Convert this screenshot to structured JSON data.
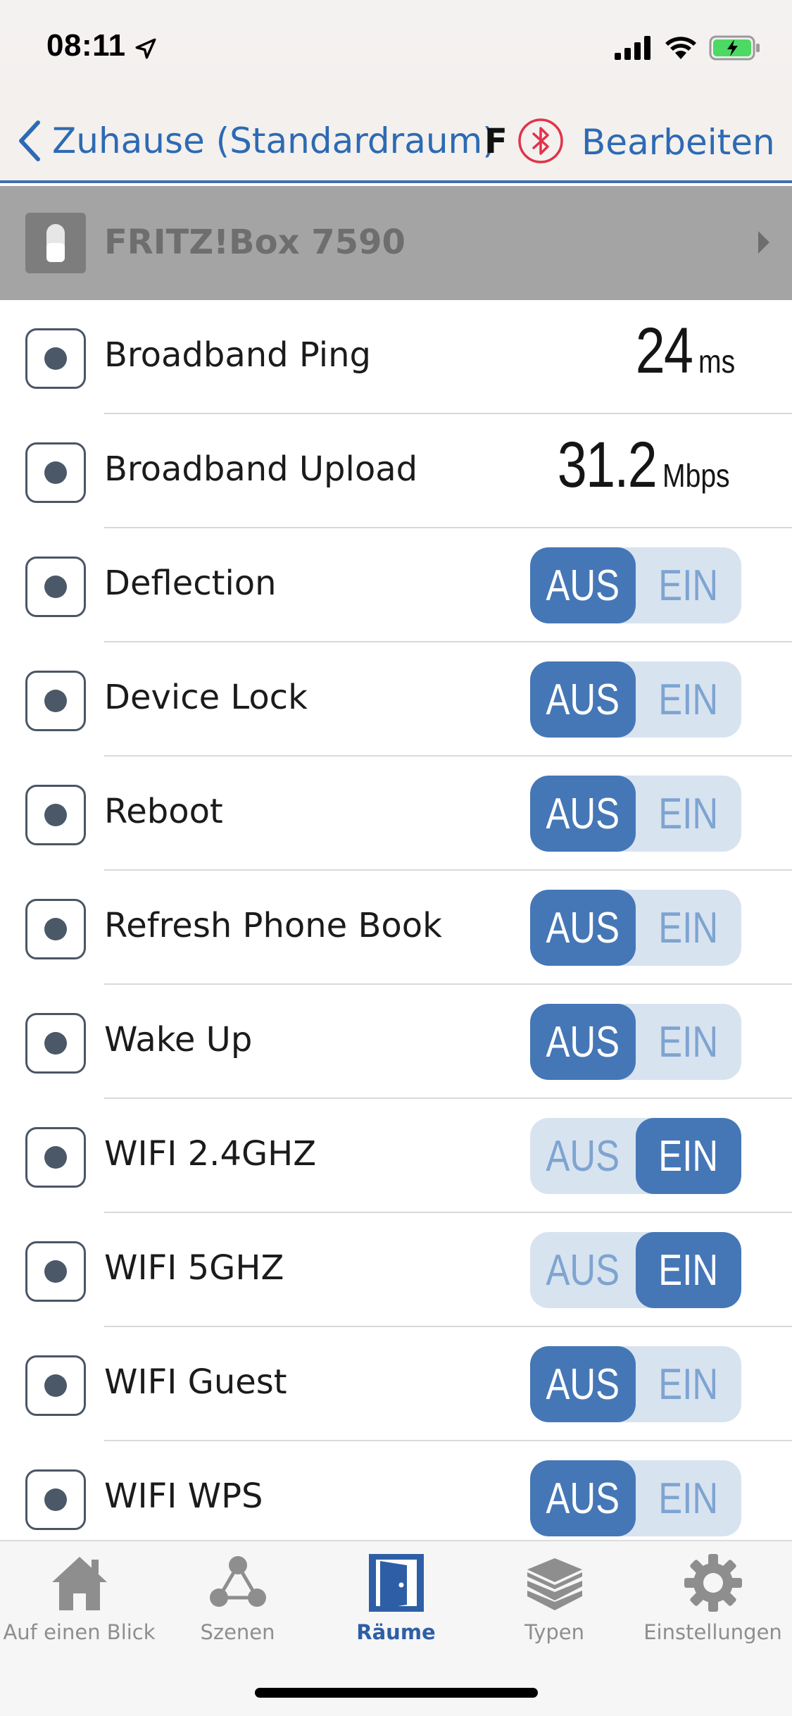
{
  "status": {
    "time": "08:11"
  },
  "nav": {
    "back_label": "Zuhause (Standardraum)",
    "title": "Fl",
    "edit_label": "Bearbeiten"
  },
  "device": {
    "name": "FRITZ!Box 7590"
  },
  "rows": [
    {
      "label": "Broadband Ping",
      "type": "value",
      "value": "24",
      "unit": "ms"
    },
    {
      "label": "Broadband Upload",
      "type": "value",
      "value": "31.2",
      "unit": "Mbps"
    },
    {
      "label": "Deflection",
      "type": "toggle",
      "state": "AUS"
    },
    {
      "label": "Device Lock",
      "type": "toggle",
      "state": "AUS"
    },
    {
      "label": "Reboot",
      "type": "toggle",
      "state": "AUS"
    },
    {
      "label": "Refresh Phone Book",
      "type": "toggle",
      "state": "AUS"
    },
    {
      "label": "Wake Up",
      "type": "toggle",
      "state": "AUS"
    },
    {
      "label": "WIFI 2.4GHZ",
      "type": "toggle",
      "state": "EIN"
    },
    {
      "label": "WIFI 5GHZ",
      "type": "toggle",
      "state": "EIN"
    },
    {
      "label": "WIFI Guest",
      "type": "toggle",
      "state": "AUS"
    },
    {
      "label": "WIFI WPS",
      "type": "toggle",
      "state": "AUS"
    }
  ],
  "toggle_labels": {
    "off": "AUS",
    "on": "EIN"
  },
  "tabs": [
    {
      "label": "Auf einen Blick",
      "icon": "house-icon"
    },
    {
      "label": "Szenen",
      "icon": "scenes-icon"
    },
    {
      "label": "Räume",
      "icon": "door-icon",
      "active": true
    },
    {
      "label": "Typen",
      "icon": "layers-icon"
    },
    {
      "label": "Einstellungen",
      "icon": "gear-icon"
    }
  ],
  "colors": {
    "accent": "#2d6ab3",
    "toggle_active": "#4577b7",
    "toggle_track": "#d8e3f0",
    "bluetooth": "#e0334a"
  }
}
